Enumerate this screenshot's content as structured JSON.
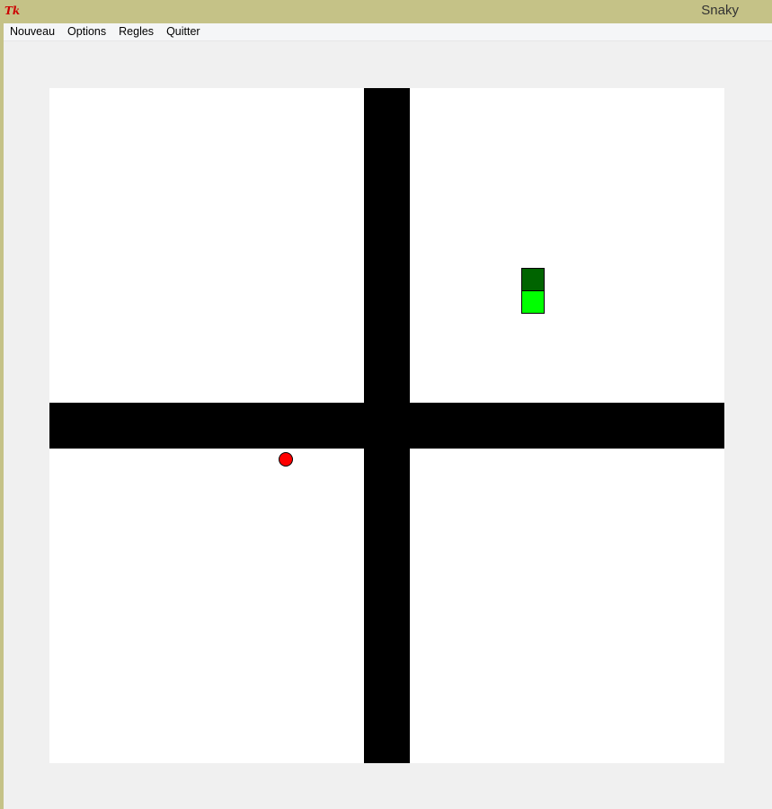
{
  "window": {
    "title": "Snaky",
    "icon": "tk-icon"
  },
  "menu": {
    "items": [
      {
        "label": "Nouveau"
      },
      {
        "label": "Options"
      },
      {
        "label": "Regles"
      },
      {
        "label": "Quitter"
      }
    ]
  },
  "game": {
    "grid_size": 30,
    "walls": "cross",
    "snake": {
      "head_color": "#006400",
      "body_color": "#00ff00",
      "segments": [
        {
          "col": 21,
          "row": 8,
          "type": "head"
        },
        {
          "col": 21,
          "row": 9,
          "type": "body"
        }
      ]
    },
    "apple": {
      "color": "#ff0000",
      "col": 10,
      "row": 16
    },
    "colors": {
      "board": "#ffffff",
      "wall": "#000000",
      "titlebar": "#c5c287",
      "window_bg": "#f0f0f0"
    }
  }
}
